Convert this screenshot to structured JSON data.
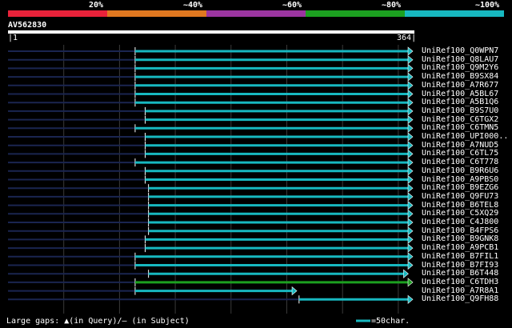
{
  "legend": {
    "labels": [
      {
        "text": "20%"
      },
      {
        "text": "~40%"
      },
      {
        "text": "~60%"
      },
      {
        "text": "~80%"
      },
      {
        "text": "~100%"
      }
    ],
    "colors": [
      "#e8223a",
      "#e07820",
      "#9b35a0",
      "#1ca020",
      "#17b8c0"
    ]
  },
  "query": {
    "name": "AV562830",
    "start": "1",
    "end": "364"
  },
  "query_length": 364,
  "hits": [
    {
      "name": "UniRef100_Q0WPN7",
      "start": 115,
      "end": 364,
      "color": "#17b8c0"
    },
    {
      "name": "UniRef100_Q8LAU7",
      "start": 115,
      "end": 364,
      "color": "#17b8c0"
    },
    {
      "name": "UniRef100_Q9M2Y6",
      "start": 115,
      "end": 364,
      "color": "#17b8c0"
    },
    {
      "name": "UniRef100_B9SX84",
      "start": 115,
      "end": 364,
      "color": "#17b8c0"
    },
    {
      "name": "UniRef100_A7R677",
      "start": 115,
      "end": 364,
      "color": "#17b8c0"
    },
    {
      "name": "UniRef100_A5BL67",
      "start": 115,
      "end": 364,
      "color": "#17b8c0"
    },
    {
      "name": "UniRef100_A5B1Q6",
      "start": 115,
      "end": 364,
      "color": "#17b8c0"
    },
    {
      "name": "UniRef100_B9S7U0",
      "start": 124,
      "end": 364,
      "color": "#17b8c0"
    },
    {
      "name": "UniRef100_C6TGX2",
      "start": 124,
      "end": 364,
      "color": "#17b8c0"
    },
    {
      "name": "UniRef100_C6TMN5",
      "start": 115,
      "end": 364,
      "color": "#17b8c0"
    },
    {
      "name": "UniRef100_UPI000..",
      "start": 124,
      "end": 364,
      "color": "#17b8c0"
    },
    {
      "name": "UniRef100_A7NUD5",
      "start": 124,
      "end": 364,
      "color": "#17b8c0"
    },
    {
      "name": "UniRef100_C6TL75",
      "start": 124,
      "end": 364,
      "color": "#17b8c0"
    },
    {
      "name": "UniRef100_C6T778",
      "start": 115,
      "end": 364,
      "color": "#17b8c0"
    },
    {
      "name": "UniRef100_B9R6U6",
      "start": 124,
      "end": 364,
      "color": "#17b8c0"
    },
    {
      "name": "UniRef100_A9PBS0",
      "start": 124,
      "end": 364,
      "color": "#17b8c0"
    },
    {
      "name": "UniRef100_B9EZG6",
      "start": 127,
      "end": 364,
      "color": "#17b8c0"
    },
    {
      "name": "UniRef100_Q9FU73",
      "start": 127,
      "end": 364,
      "color": "#17b8c0"
    },
    {
      "name": "UniRef100_B6TEL8",
      "start": 127,
      "end": 364,
      "color": "#17b8c0"
    },
    {
      "name": "UniRef100_C5XQ29",
      "start": 127,
      "end": 364,
      "color": "#17b8c0"
    },
    {
      "name": "UniRef100_C4J800",
      "start": 127,
      "end": 364,
      "color": "#17b8c0"
    },
    {
      "name": "UniRef100_B4FPS6",
      "start": 127,
      "end": 364,
      "color": "#17b8c0"
    },
    {
      "name": "UniRef100_B9GNK8",
      "start": 124,
      "end": 364,
      "color": "#17b8c0"
    },
    {
      "name": "UniRef100_A9PCB1",
      "start": 124,
      "end": 364,
      "color": "#17b8c0"
    },
    {
      "name": "UniRef100_B7FIL1",
      "start": 115,
      "end": 364,
      "color": "#17b8c0"
    },
    {
      "name": "UniRef100_B7FI93",
      "start": 115,
      "end": 364,
      "color": "#17b8c0"
    },
    {
      "name": "UniRef100_B6T448",
      "start": 127,
      "end": 360,
      "color": "#17b8c0"
    },
    {
      "name": "UniRef100_C6TDH3",
      "start": 115,
      "end": 364,
      "color": "#1ca020"
    },
    {
      "name": "UniRef100_A7R8A1",
      "start": 115,
      "end": 260,
      "color": "#17b8c0"
    },
    {
      "name": "UniRef100_Q9FH88",
      "start": 262,
      "end": 364,
      "color": "#17b8c0"
    }
  ],
  "footer": {
    "text": "Large gaps: ▲(in Query)/– (in Subject)",
    "scale": "=50char."
  }
}
